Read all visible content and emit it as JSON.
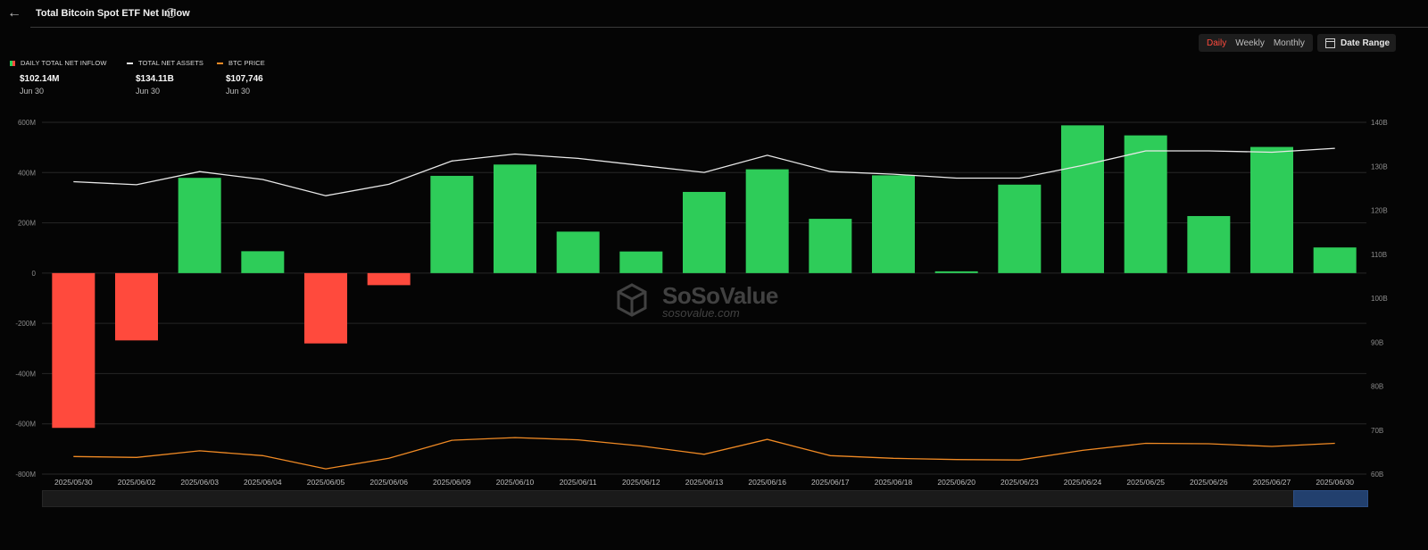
{
  "header": {
    "back_icon": "arrow-left-icon",
    "title": "Total Bitcoin Spot ETF Net Inflow",
    "info_icon": "info-icon"
  },
  "controls": {
    "tabs": [
      "Daily",
      "Weekly",
      "Monthly"
    ],
    "active_tab": "Daily",
    "date_range_label": "Date Range",
    "date_range_icon": "calendar-icon"
  },
  "legend": {
    "items": [
      {
        "label": "DAILY TOTAL NET INFLOW",
        "value": "$102.14M",
        "date": "Jun 30"
      },
      {
        "label": "TOTAL NET ASSETS",
        "value": "$134.11B",
        "date": "Jun 30"
      },
      {
        "label": "BTC PRICE",
        "value": "$107,746",
        "date": "Jun 30"
      }
    ]
  },
  "watermark": {
    "name": "SoSoValue",
    "url": "sosovalue.com"
  },
  "colors": {
    "positive": "#2ecc59",
    "negative": "#ff4a3d",
    "assets_line": "#e8e8e8",
    "price_line": "#f08a24",
    "accent": "#ff4a3d"
  },
  "chart_data": {
    "type": "bar",
    "title": "Total Bitcoin Spot ETF Net Inflow",
    "categories": [
      "2025/05/30",
      "2025/06/02",
      "2025/06/03",
      "2025/06/04",
      "2025/06/05",
      "2025/06/06",
      "2025/06/09",
      "2025/06/10",
      "2025/06/11",
      "2025/06/12",
      "2025/06/13",
      "2025/06/16",
      "2025/06/17",
      "2025/06/18",
      "2025/06/20",
      "2025/06/23",
      "2025/06/24",
      "2025/06/25",
      "2025/06/26",
      "2025/06/27",
      "2025/06/30"
    ],
    "series": [
      {
        "name": "DAILY TOTAL NET INFLOW",
        "type": "bar",
        "axis": "left",
        "unit": "M",
        "values": [
          -616,
          -268,
          379,
          87,
          -280,
          -48,
          387,
          432,
          165,
          86,
          323,
          413,
          216,
          389,
          7,
          352,
          588,
          548,
          227,
          502,
          102
        ]
      },
      {
        "name": "TOTAL NET ASSETS",
        "type": "line",
        "axis": "right",
        "unit": "B",
        "values": [
          126.5,
          125.8,
          128.8,
          127.0,
          123.3,
          125.9,
          131.2,
          132.8,
          131.8,
          130.2,
          128.6,
          132.5,
          128.8,
          128.2,
          127.3,
          127.3,
          130.2,
          133.5,
          133.5,
          133.2,
          134.1
        ]
      },
      {
        "name": "BTC PRICE",
        "type": "line",
        "axis": "right",
        "unit": "B",
        "values": [
          64.0,
          63.8,
          65.3,
          64.2,
          61.2,
          63.6,
          67.7,
          68.3,
          67.8,
          66.4,
          64.5,
          67.9,
          64.2,
          63.6,
          63.3,
          63.2,
          65.4,
          67.0,
          66.9,
          66.3,
          67.0
        ]
      }
    ],
    "y_left": {
      "ticks": [
        "600M",
        "400M",
        "200M",
        "0",
        "-200M",
        "-400M",
        "-600M",
        "-800M"
      ],
      "ylim": [
        -800,
        600
      ]
    },
    "y_right": {
      "ticks": [
        "140B",
        "130B",
        "120B",
        "110B",
        "100B",
        "90B",
        "80B",
        "70B",
        "60B"
      ],
      "ylim": [
        60,
        140
      ]
    },
    "grid": true,
    "legend_position": "top-left"
  }
}
